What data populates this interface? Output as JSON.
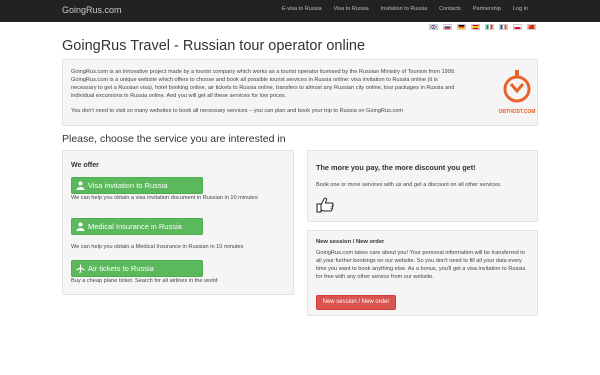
{
  "nav": {
    "brand": "GoingRus.com",
    "links": [
      "E-visa to Russia",
      "Visa to Russia",
      "Invitation to Russia",
      "Contacts",
      "Partnership",
      "Log in"
    ]
  },
  "languages": [
    "english-flag",
    "russian-flag",
    "german-flag",
    "spanish-flag",
    "italian-flag",
    "french-flag",
    "polish-flag",
    "chinese-flag"
  ],
  "page": {
    "title": "GoingRus Travel - Russian tour operator online",
    "intro_p1": "GoingRus.com is an innovative project made by a tourist company which works as a tourist operator licensed by the Russian Ministry of Tourism from 1999. GoingRus.com is a unique website which offers to choose and book all possible tourist services in Russia online: visa invitation to Russia online (it is necessary to get a Russian visa), hotel booking online, air tickets to Russia online, transfers to almost any Russian city online, tour packages in Russia and individual excursions in Russia online. And you will get all these services for low prices.",
    "intro_p2": "You don't need to visit so many websites to book all necessary services – you can plan and book your trip to Russia on GoingRus.com",
    "logo_text": "OBTHOST.COM",
    "choose_heading": "Please, choose the service you are interested in"
  },
  "offer": {
    "heading": "We offer",
    "services": [
      {
        "label": "Visa invitation to Russia",
        "icon": "user-icon",
        "desc": "We can help you obtain a visa invitation document in Russian in 10 minutes"
      },
      {
        "label": "Medical Insurance in Russia",
        "icon": "user-icon",
        "desc": "We can help you obtain a Medical Insurance in Russian in 10 minutes"
      },
      {
        "label": "Air tickets to Russia",
        "icon": "plane-icon",
        "desc": "Buy a cheap plane ticket. Search for all airlines in the world"
      }
    ]
  },
  "discount": {
    "heading": "The more you pay, the more discount you get!",
    "text": "Book one or more services with us and get a discount on all other services."
  },
  "session": {
    "heading": "New session / New order",
    "text": "GoingRus.com takes care about you! Your personal information will be transferred to all your further bookings on our website. So you don't need to fill all your data every time you want to book anything else. As a bonus, you'll get a visa invitation to Russia for free with any other service from our website.",
    "button": "New session / New order"
  },
  "colors": {
    "navbar": "#222222",
    "green": "#5cb85c",
    "red": "#d9534f",
    "logo_orange": "#e8622a"
  }
}
